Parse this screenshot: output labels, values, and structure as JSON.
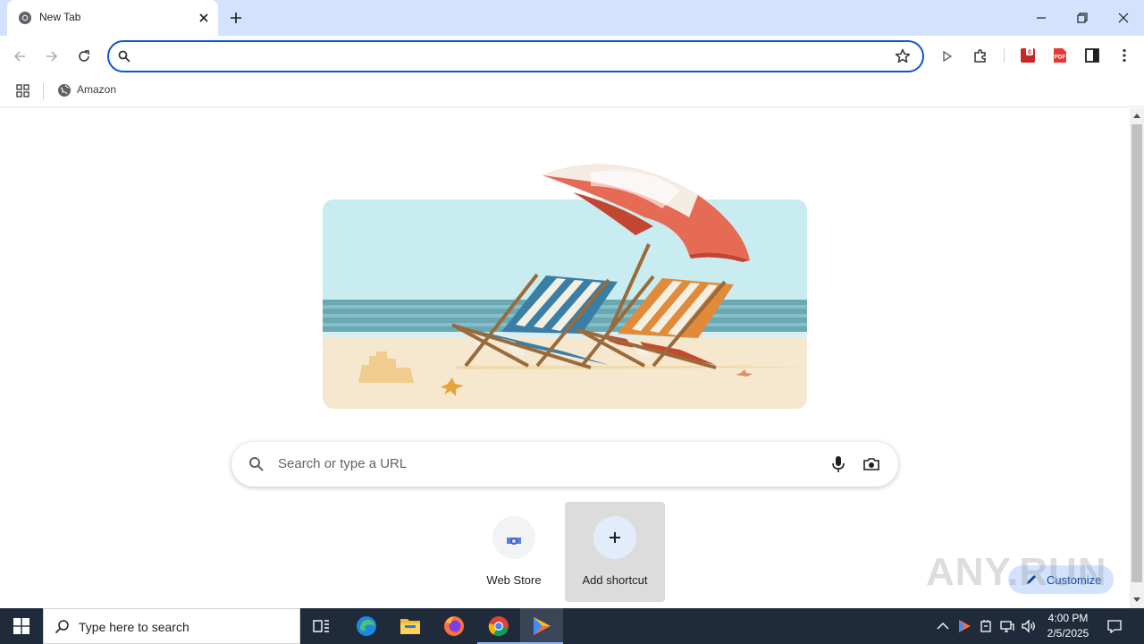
{
  "tab": {
    "title": "New Tab"
  },
  "omnibox": {
    "value": ""
  },
  "bookmarks": [
    {
      "label": "Amazon"
    }
  ],
  "ntp": {
    "search_placeholder": "Search or type a URL",
    "shortcuts": [
      {
        "label": "Web Store"
      },
      {
        "label": "Add shortcut"
      }
    ],
    "customize_label": "Customize",
    "watermark": "ANY.RUN"
  },
  "taskbar": {
    "search_placeholder": "Type here to search",
    "time": "4:00 PM",
    "date": "2/5/2025"
  },
  "icons": {
    "chrome_favicon": "chrome-icon",
    "extensions": "puzzle-icon",
    "sidebar": "side-panel-icon"
  },
  "colors": {
    "accent": "#0b57d0",
    "tabstrip": "#d3e3fd",
    "taskbar": "#1f2a3a"
  }
}
